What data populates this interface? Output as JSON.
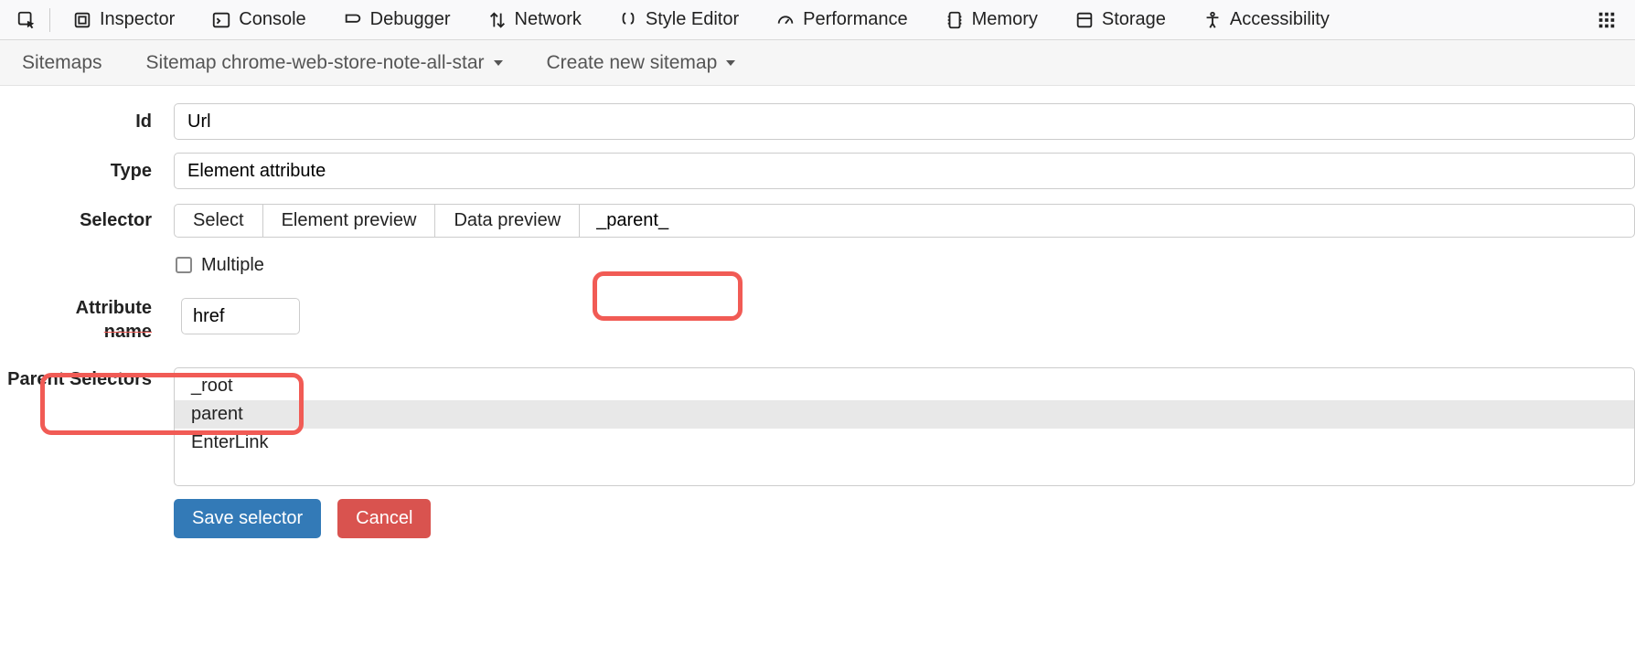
{
  "devtools": {
    "picker": "",
    "tabs": [
      {
        "id": "inspector",
        "label": "Inspector"
      },
      {
        "id": "console",
        "label": "Console"
      },
      {
        "id": "debugger",
        "label": "Debugger"
      },
      {
        "id": "network",
        "label": "Network"
      },
      {
        "id": "style-editor",
        "label": "Style Editor"
      },
      {
        "id": "performance",
        "label": "Performance"
      },
      {
        "id": "memory",
        "label": "Memory"
      },
      {
        "id": "storage",
        "label": "Storage"
      },
      {
        "id": "accessibility",
        "label": "Accessibility"
      }
    ]
  },
  "extNav": {
    "sitemaps": "Sitemaps",
    "sitemap": "Sitemap chrome-web-store-note-all-star",
    "create": "Create new sitemap"
  },
  "form": {
    "id": {
      "label": "Id",
      "value": "Url"
    },
    "type": {
      "label": "Type",
      "value": "Element attribute"
    },
    "selector": {
      "label": "Selector",
      "select_btn": "Select",
      "elem_preview": "Element preview",
      "data_preview": "Data preview",
      "value": "_parent_"
    },
    "multiple": {
      "label": "Multiple",
      "checked": false
    },
    "attribute": {
      "label1": "Attribute",
      "label2": "name",
      "value": "href"
    },
    "parent": {
      "label": "Parent Selectors",
      "options": [
        "_root",
        "parent",
        "EnterLink"
      ],
      "selected": "parent"
    },
    "actions": {
      "save": "Save selector",
      "cancel": "Cancel"
    }
  }
}
